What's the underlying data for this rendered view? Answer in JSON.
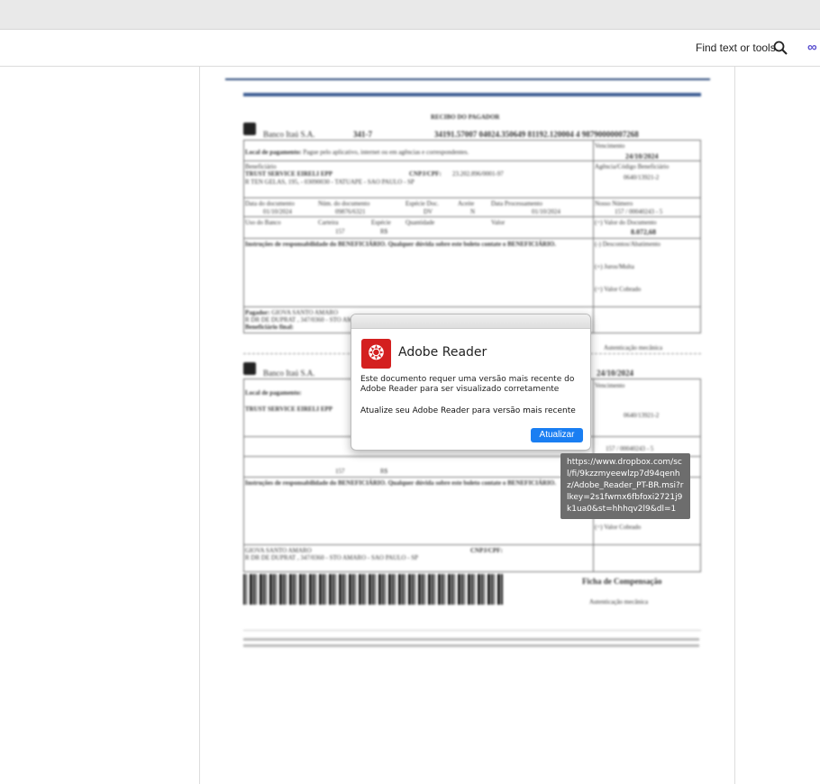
{
  "toolbar": {
    "find_label": "Find text or tools"
  },
  "document": {
    "receipt_title": "RECIBO DO PAGADOR",
    "bank": "Banco Itaú S.A.",
    "bank_code": "341-7",
    "digitable_line": "34191.57007 04024.350649 81192.120004 4 98790000007268",
    "payment_place_label": "Local de pagamento:",
    "payment_place": "Pague pelo aplicativo, internet ou em agências e correspondentes.",
    "due_label": "Vencimento",
    "due": "24/10/2024",
    "beneficiary_label": "Beneficiário",
    "beneficiary": "TRUST SERVICE EIRELI EPP",
    "cnpj_label": "CNPJ/CPF:",
    "cnpj": "23.202.896/0001-97",
    "address": "R TEN GELAS, 195, - 03090030 - TATUAPE - SAO PAULO - SP",
    "agency_label": "Agência/Código Beneficiário",
    "agency": "0640/13921-2",
    "doc_date_label": "Data do documento",
    "doc_date": "01/10/2024",
    "doc_num_label": "Núm. do documento",
    "doc_num": "09876/6321",
    "species_doc_label": "Espécie Doc.",
    "species_doc": "DV",
    "accept_label": "Aceite",
    "accept": "N",
    "proc_date_label": "Data Processamento",
    "proc_date": "01/10/2024",
    "our_num_label": "Nosso Número",
    "our_num": "157 / 00040243 - 5",
    "bank_use_label": "Uso do Banco",
    "wallet_label": "Carteira",
    "wallet": "157",
    "species_label": "Espécie",
    "species": "R$",
    "qty_label": "Quantidade",
    "value_label": "Valor",
    "doc_value_label": "(=) Valor do Documento",
    "doc_value": "8.072,68",
    "instructions": "Instruções de responsabilidade do BENEFICIÁRIO. Qualquer dúvida sobre este boleto contate o BENEFICIÁRIO.",
    "discount_label": "(-) Descontos/Abatimento",
    "interest_label": "(+) Juros/Multa",
    "charged_label": "(=) Valor Cobrado",
    "payer_label": "Pagador:",
    "payer": "GIOVA SANTO AMARO",
    "payer_address": "R DR DE DUPRAT , 347/0360 - STO AMARO - SAO PAULO - SP",
    "final_beneficiary": "Beneficiário final:",
    "mech_auth": "Autenticação mecânica",
    "compensation": "Ficha de Compensação"
  },
  "dialog": {
    "app_name": "Adobe Reader",
    "message": "Este documento requer uma versão mais recente do Adobe Reader para ser visualizado corretamente",
    "prompt": "Atualize seu Adobe Reader para versão mais recente",
    "button": "Atualizar"
  },
  "tooltip": {
    "url": "https://www.dropbox.com/scl/fi/9kzzmyeewlzp7d94qenhz/Adobe_Reader_PT-BR.msi?rlkey=2s1fwmx6fbfoxi2721j9k1ua0&st=hhhqv2l9&dl=1"
  },
  "colors": {
    "accent": "#1a7ef2",
    "adobe_red": "#d4201f",
    "doc_bar": "#2c4a7a"
  }
}
